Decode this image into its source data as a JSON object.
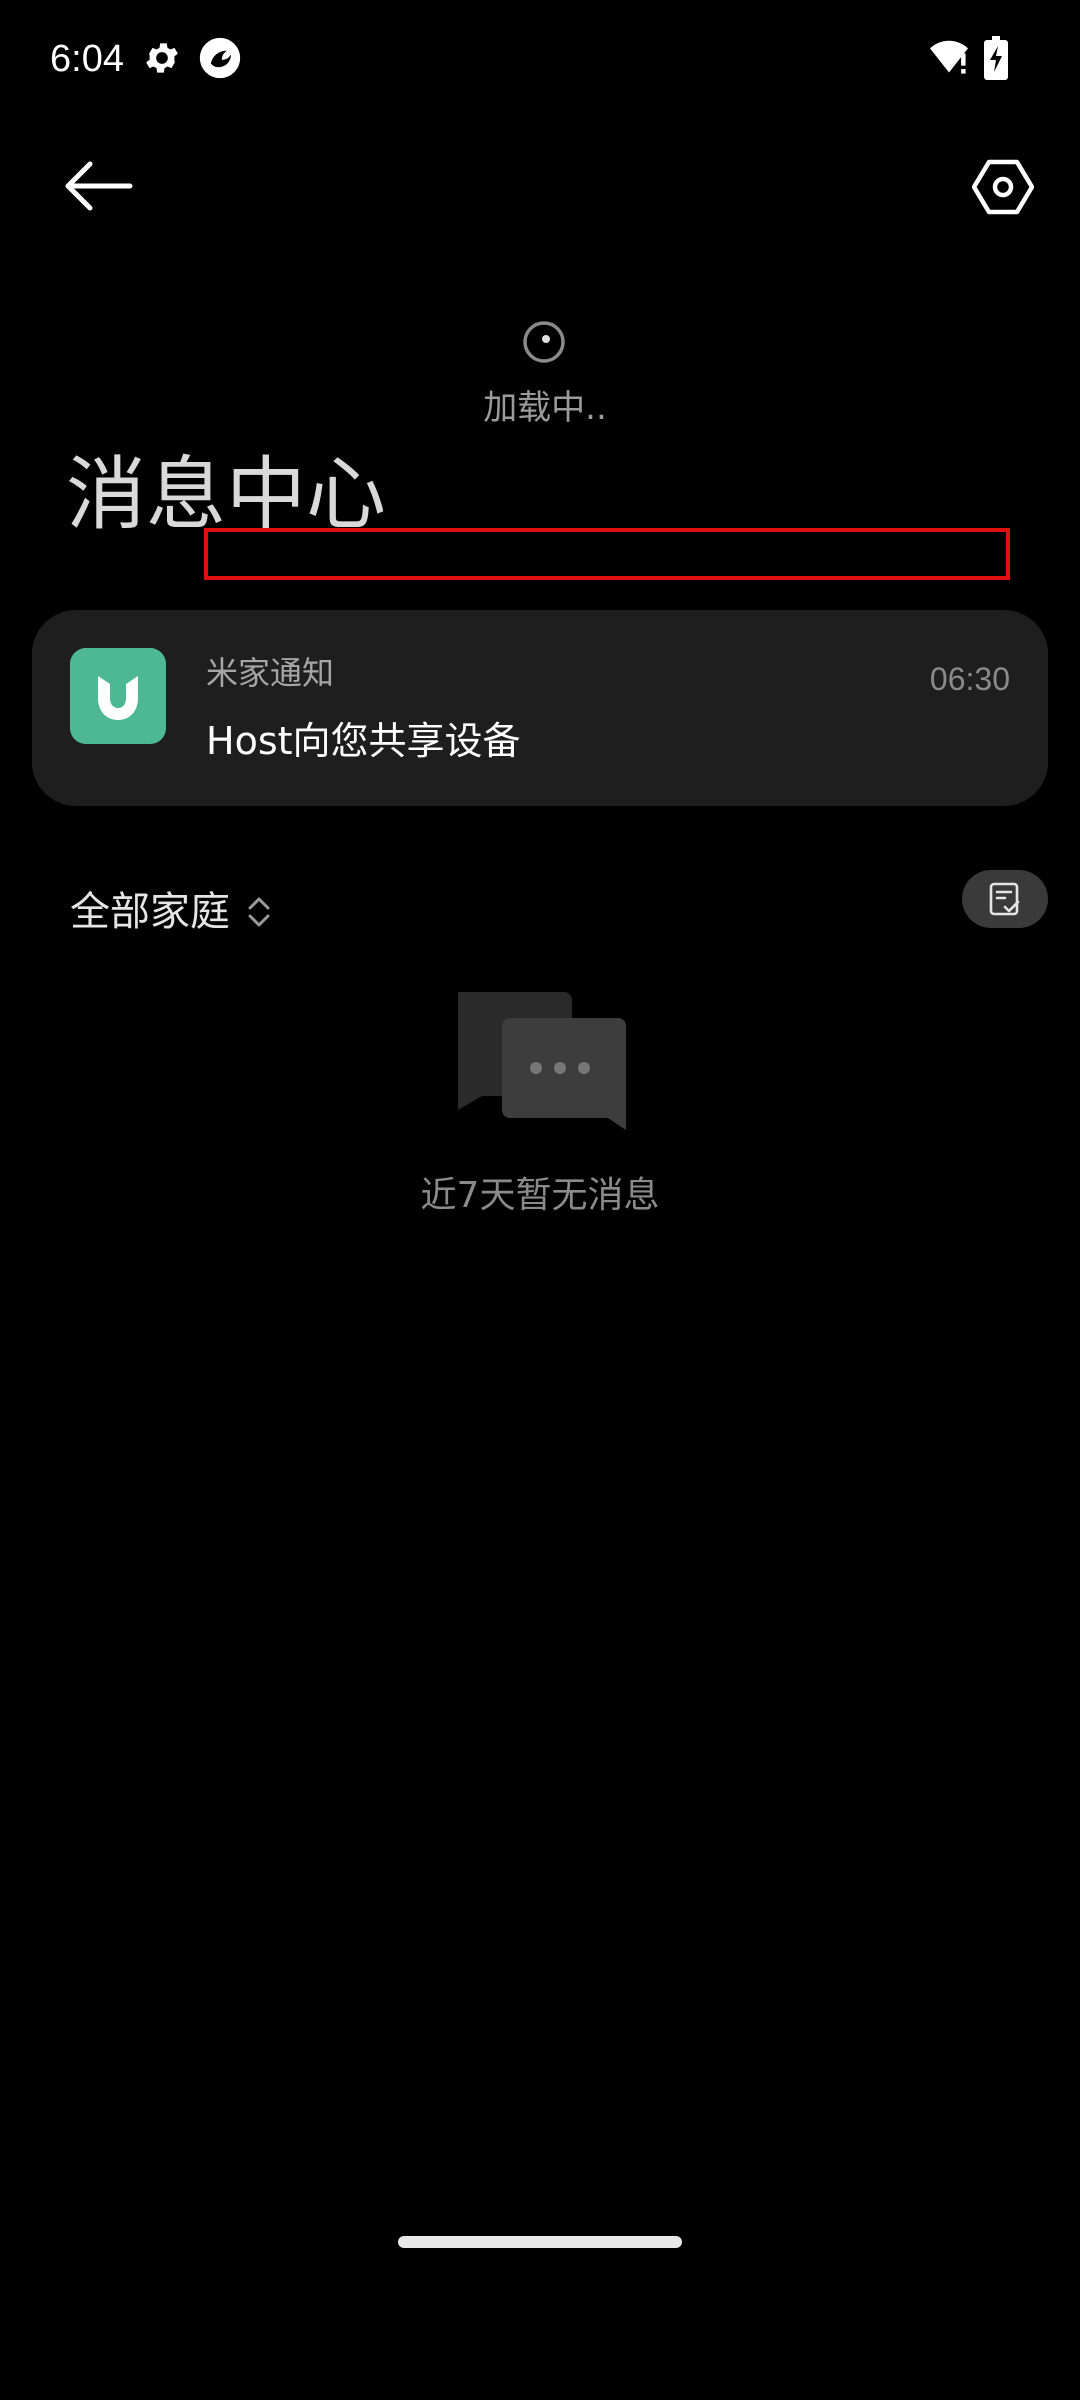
{
  "status_bar": {
    "time": "6:04",
    "icons": [
      "gear-icon",
      "app-icon",
      "wifi-icon",
      "battery-icon"
    ]
  },
  "nav": {
    "back_icon": "back-arrow-icon",
    "settings_icon": "settings-hexagon-icon"
  },
  "loading": {
    "text": "加载中.."
  },
  "page_title": "消息中心",
  "notification": {
    "source": "米家通知",
    "time": "06:30",
    "message": "Host向您共享设备",
    "icon": "mijia-logo-icon",
    "icon_color": "#4db893"
  },
  "filter": {
    "label": "全部家庭",
    "sort_icon": "sort-updown-icon",
    "mark_read_icon": "mark-all-read-icon"
  },
  "empty_state": {
    "icon": "chat-bubbles-icon",
    "text": "近7天暂无消息"
  },
  "colors": {
    "background": "#000000",
    "card": "#1e1e1e",
    "highlight": "#e01010"
  }
}
